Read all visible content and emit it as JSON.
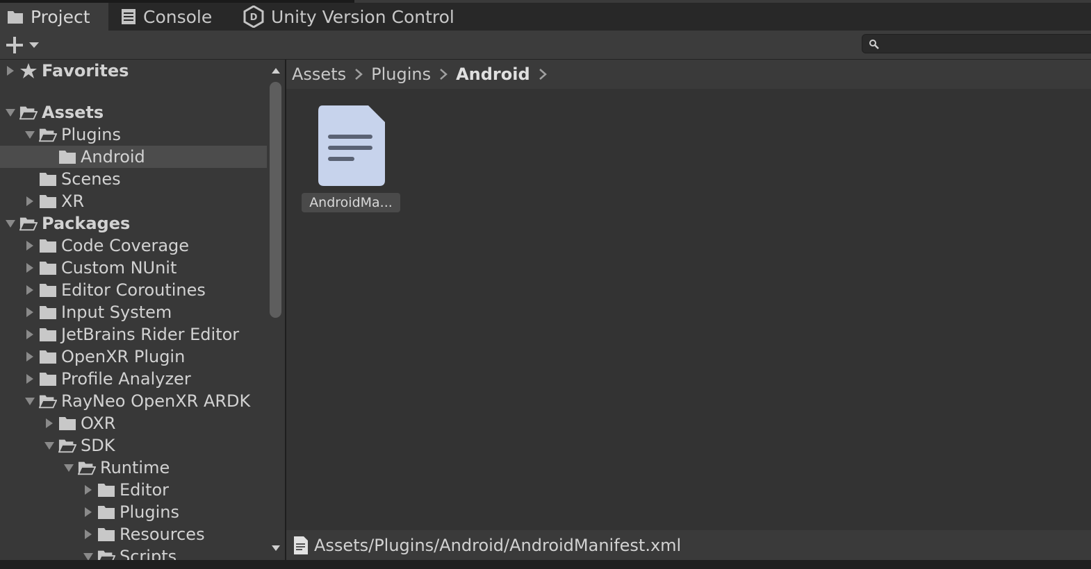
{
  "tabs": [
    {
      "label": "Project",
      "icon": "folder-icon",
      "active": true
    },
    {
      "label": "Console",
      "icon": "console-icon",
      "active": false
    },
    {
      "label": "Unity Version Control",
      "icon": "version-control-icon",
      "active": false
    }
  ],
  "toolbar": {
    "create_icon": "plus-icon",
    "dropdown_icon": "chevron-down-icon",
    "search_placeholder": "",
    "search_icon": "search-icon"
  },
  "tree": [
    {
      "label": "Favorites",
      "depth": 0,
      "arrow": "collapsed",
      "icon": "star",
      "bold": true
    },
    {
      "label": "Assets",
      "depth": 0,
      "arrow": "expanded",
      "icon": "folder-open",
      "bold": true
    },
    {
      "label": "Plugins",
      "depth": 1,
      "arrow": "expanded",
      "icon": "folder-open"
    },
    {
      "label": "Android",
      "depth": 2,
      "arrow": "none",
      "icon": "folder",
      "selected": true
    },
    {
      "label": "Scenes",
      "depth": 1,
      "arrow": "none",
      "icon": "folder"
    },
    {
      "label": "XR",
      "depth": 1,
      "arrow": "collapsed",
      "icon": "folder"
    },
    {
      "label": "Packages",
      "depth": 0,
      "arrow": "expanded",
      "icon": "folder-open",
      "bold": true
    },
    {
      "label": "Code Coverage",
      "depth": 1,
      "arrow": "collapsed",
      "icon": "folder"
    },
    {
      "label": "Custom NUnit",
      "depth": 1,
      "arrow": "collapsed",
      "icon": "folder"
    },
    {
      "label": "Editor Coroutines",
      "depth": 1,
      "arrow": "collapsed",
      "icon": "folder"
    },
    {
      "label": "Input System",
      "depth": 1,
      "arrow": "collapsed",
      "icon": "folder"
    },
    {
      "label": "JetBrains Rider Editor",
      "depth": 1,
      "arrow": "collapsed",
      "icon": "folder"
    },
    {
      "label": "OpenXR Plugin",
      "depth": 1,
      "arrow": "collapsed",
      "icon": "folder"
    },
    {
      "label": "Profile Analyzer",
      "depth": 1,
      "arrow": "collapsed",
      "icon": "folder"
    },
    {
      "label": "RayNeo OpenXR ARDK",
      "depth": 1,
      "arrow": "expanded",
      "icon": "folder-open"
    },
    {
      "label": "OXR",
      "depth": 2,
      "arrow": "collapsed",
      "icon": "folder"
    },
    {
      "label": "SDK",
      "depth": 2,
      "arrow": "expanded",
      "icon": "folder-open"
    },
    {
      "label": "Runtime",
      "depth": 3,
      "arrow": "expanded",
      "icon": "folder-open"
    },
    {
      "label": "Editor",
      "depth": 4,
      "arrow": "collapsed",
      "icon": "folder"
    },
    {
      "label": "Plugins",
      "depth": 4,
      "arrow": "collapsed",
      "icon": "folder"
    },
    {
      "label": "Resources",
      "depth": 4,
      "arrow": "collapsed",
      "icon": "folder"
    },
    {
      "label": "Scripts",
      "depth": 4,
      "arrow": "expanded",
      "icon": "folder-open"
    }
  ],
  "breadcrumb": [
    "Assets",
    "Plugins",
    "Android"
  ],
  "assets": [
    {
      "label": "AndroidMa...",
      "icon": "text-file-icon"
    }
  ],
  "status": {
    "path": "Assets/Plugins/Android/AndroidManifest.xml",
    "icon": "text-file-icon"
  }
}
